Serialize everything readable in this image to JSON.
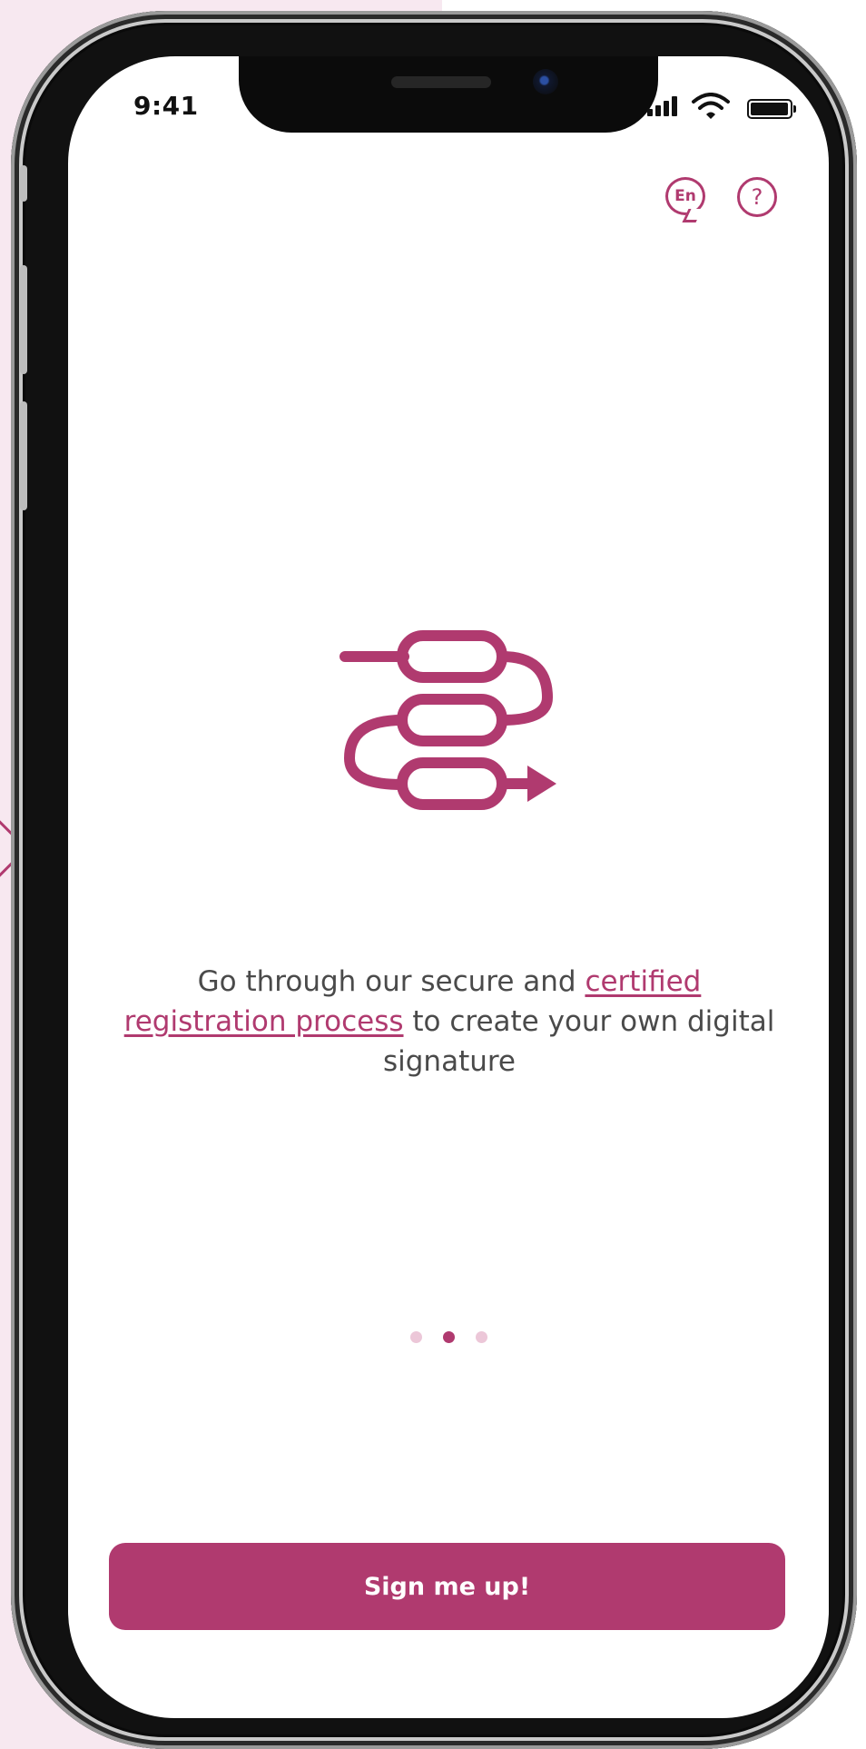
{
  "status_bar": {
    "time": "9:41",
    "icons": [
      "signal-icon",
      "wifi-icon",
      "battery-icon"
    ]
  },
  "header": {
    "language_label": "En",
    "help_label": "?"
  },
  "onboarding": {
    "illustration": "registration-process-icon",
    "text_part1": "Go through our secure and ",
    "link_text": "certified registration process",
    "text_part2": " to create your own digital signature"
  },
  "pagination": {
    "total": 3,
    "active_index": 1
  },
  "actions": {
    "primary_label": "Sign me up!"
  },
  "colors": {
    "accent": "#b03a6f",
    "accent_light": "#ecc7d8",
    "text": "#4a4a4a",
    "background": "#ffffff",
    "outer_background": "#f7e8f0"
  }
}
